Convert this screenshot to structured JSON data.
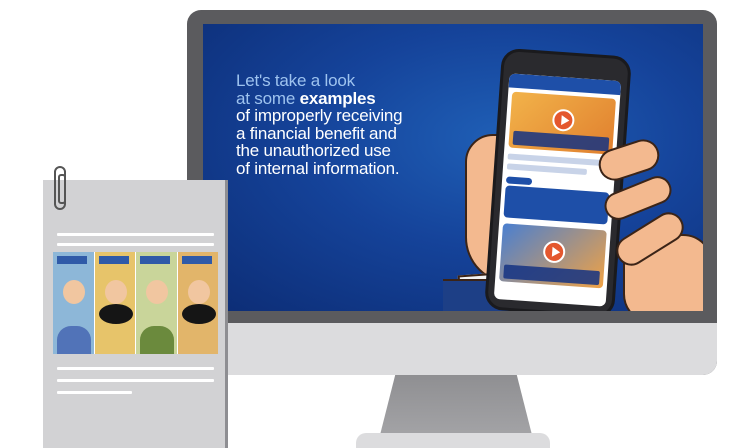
{
  "video": {
    "line1": "Let's take a look",
    "line2_prefix": "at some ",
    "line2_bold": "examples",
    "line3": "of improperly receiving",
    "line4": "a financial benefit and",
    "line5": "the unauthorized use",
    "line6": "of internal information."
  },
  "colors": {
    "screen_blue": "#15439a",
    "monitor_bezel": "#5b5b5e",
    "play_accent": "#e4572e",
    "document_gray": "#d2d2d4"
  },
  "icons": {
    "play": "play-icon",
    "paperclip": "paperclip-icon"
  }
}
